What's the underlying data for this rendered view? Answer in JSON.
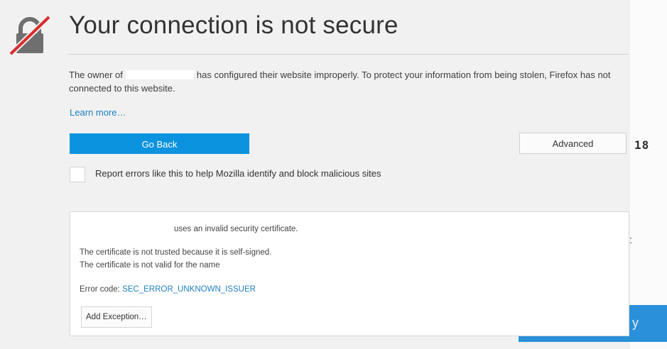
{
  "header": {
    "title": "Your connection is not secure",
    "icon": "broken-lock-icon"
  },
  "description": {
    "prefix": "The owner of",
    "suffix": "has configured their website improperly. To protect your information from being stolen, Firefox has not connected to this website."
  },
  "learn_more": "Learn more…",
  "actions": {
    "go_back": "Go Back",
    "advanced": "Advanced"
  },
  "report": {
    "checked": false,
    "label": "Report errors like this to help Mozilla identify and block malicious sites"
  },
  "side_number": "18",
  "advanced_panel": {
    "invalid_cert": "uses an invalid security certificate.",
    "not_trusted": "The certificate is not trusted because it is self-signed.",
    "not_valid_name": "The certificate is not valid for the name",
    "error_code_label": "Error code:",
    "error_code": "SEC_ERROR_UNKNOWN_ISSUER",
    "add_exception": "Add Exception…"
  },
  "colors": {
    "primary_button": "#0c93e0",
    "link": "#1e7fc4",
    "lock_slash": "#d92c2c",
    "background": "#f1f1f1"
  }
}
